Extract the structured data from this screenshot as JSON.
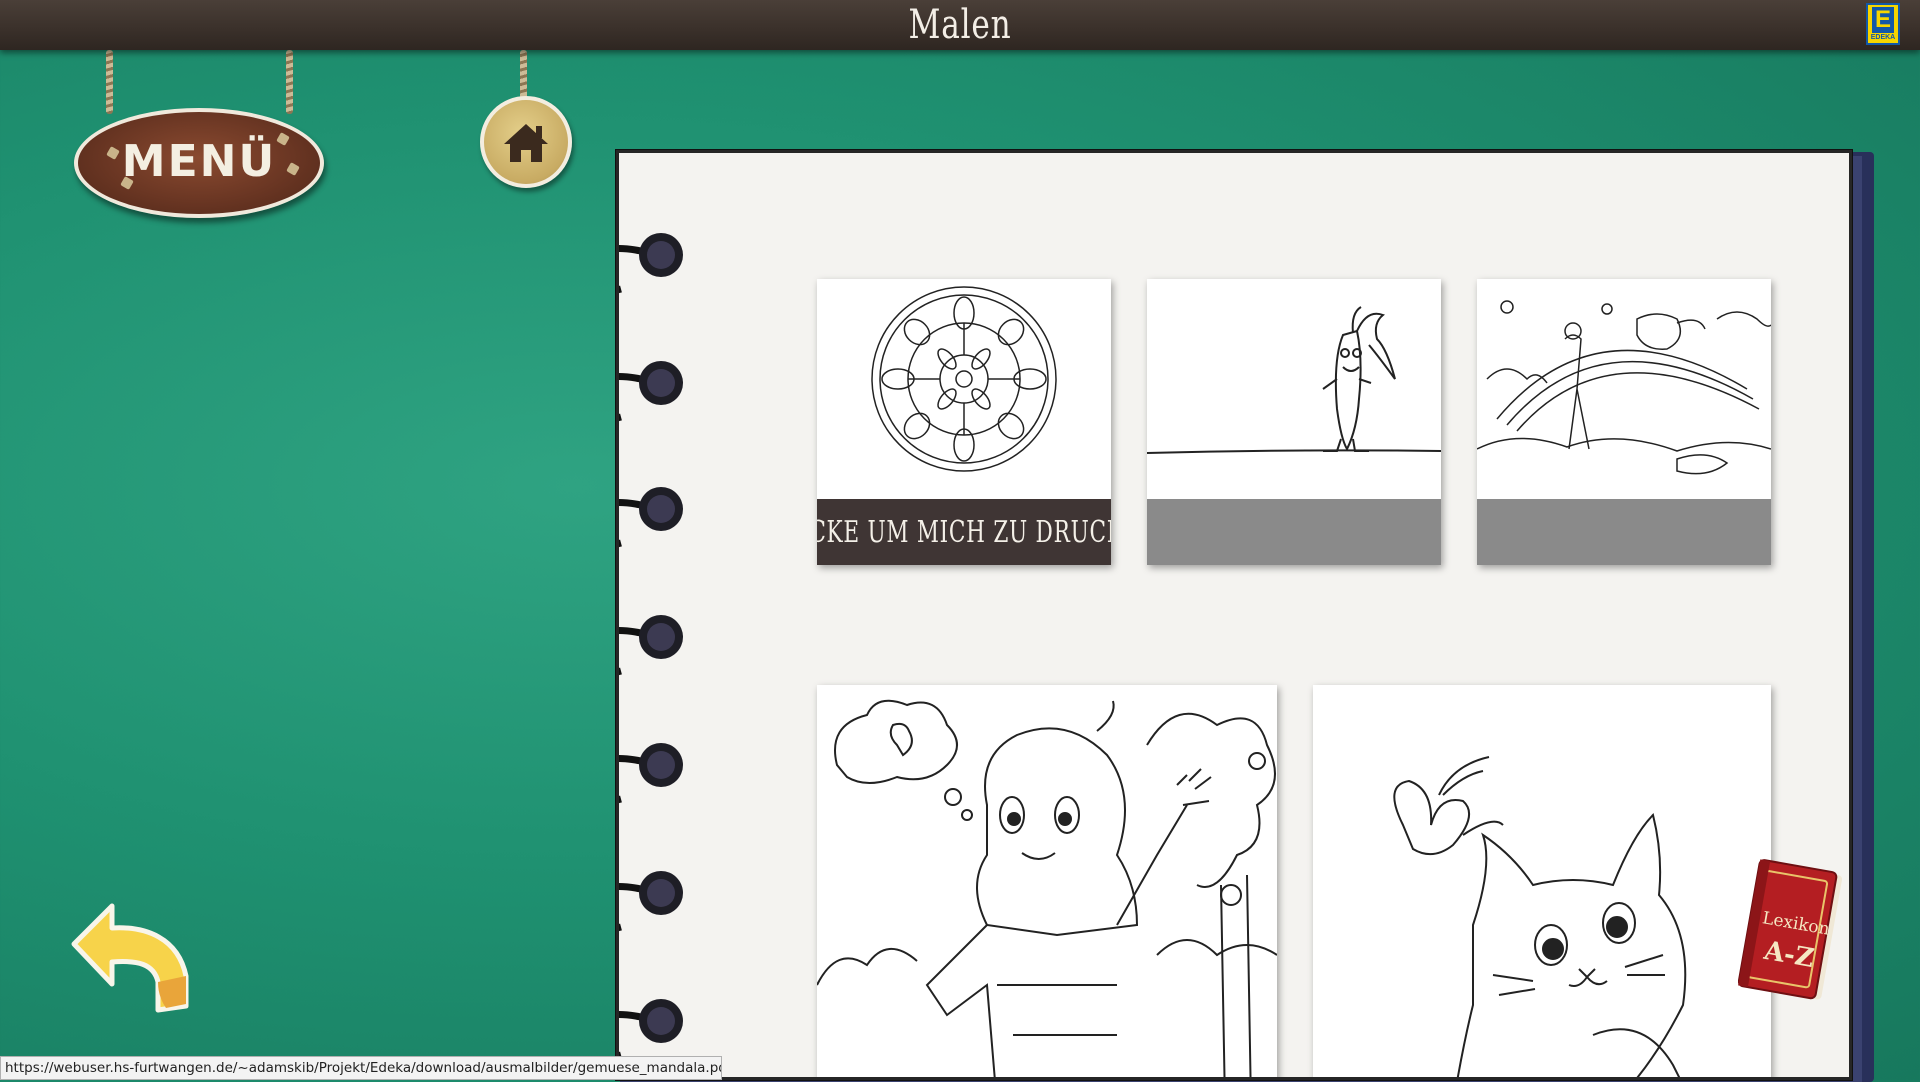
{
  "header": {
    "title": "Malen",
    "brand_logo": "edeka-logo",
    "brand_letter": "E",
    "brand_text": "EDEKA"
  },
  "nav": {
    "menu_label": "MENÜ",
    "home_icon": "house-icon",
    "back_icon": "back-arrow-icon"
  },
  "gallery": {
    "hover_caption": "KLICKE UM MICH ZU DRUCKEN",
    "items": [
      {
        "name": "vegetable-mandala",
        "caption": "KLICKE UM MICH ZU DRUCKEN"
      },
      {
        "name": "carrot-character",
        "caption": ""
      },
      {
        "name": "teapot-rainbow",
        "caption": ""
      },
      {
        "name": "girl-apple-tree",
        "caption": ""
      },
      {
        "name": "cat-butterfly",
        "caption": ""
      }
    ]
  },
  "lexikon": {
    "line1": "Lexikon",
    "line2": "A-Z"
  },
  "status_bar": {
    "url": "https://webuser.hs-furtwangen.de/~adamskib/Projekt/Edeka/download/ausmalbilder/gemuese_mandala.pdf"
  },
  "colors": {
    "background": "#1f9171",
    "topbar": "#3a302a",
    "caption_active": "#3f3534",
    "caption_inactive": "#8a8a8a",
    "paper": "#f4f3f0"
  }
}
